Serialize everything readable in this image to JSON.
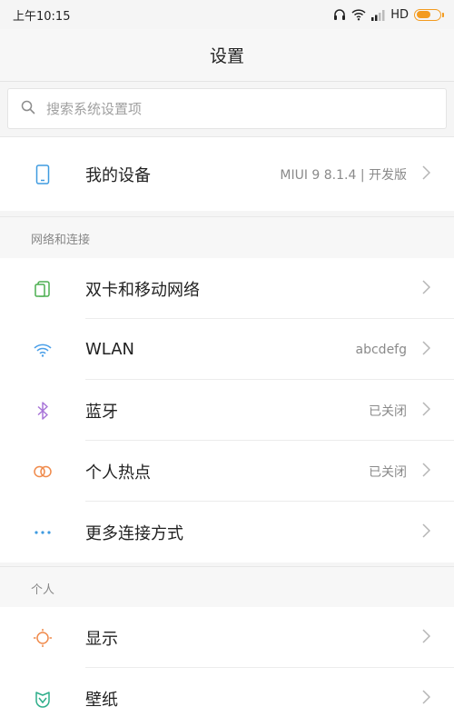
{
  "status_bar": {
    "time": "上午10:15",
    "network_label": "HD"
  },
  "title_bar": {
    "title": "设置"
  },
  "search": {
    "placeholder": "搜索系统设置项"
  },
  "my_device": {
    "label": "我的设备",
    "value": "MIUI 9 8.1.4 | 开发版"
  },
  "sections": {
    "network": {
      "header": "网络和连接",
      "items": [
        {
          "label": "双卡和移动网络",
          "value": ""
        },
        {
          "label": "WLAN",
          "value": "abcdefg"
        },
        {
          "label": "蓝牙",
          "value": "已关闭"
        },
        {
          "label": "个人热点",
          "value": "已关闭"
        },
        {
          "label": "更多连接方式",
          "value": ""
        }
      ]
    },
    "personal": {
      "header": "个人",
      "items": [
        {
          "label": "显示",
          "value": ""
        },
        {
          "label": "壁纸",
          "value": ""
        }
      ]
    }
  },
  "colors": {
    "battery": "#f39b1f",
    "sim_icon": "#4caf50",
    "wlan_icon": "#4a9fe8",
    "bluetooth_icon": "#a875d8",
    "hotspot_icon": "#f08a4b",
    "more_icon": "#3f9be0",
    "display_icon": "#f08a4b",
    "wallpaper_icon": "#2eae8a"
  }
}
